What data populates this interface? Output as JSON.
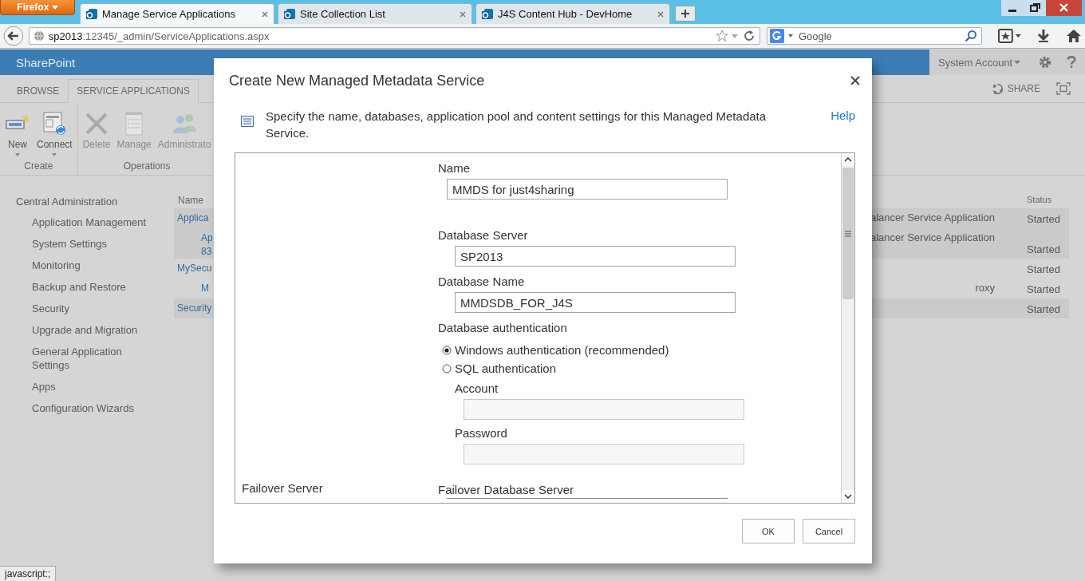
{
  "browser": {
    "menu_button": "Firefox",
    "tabs": [
      {
        "title": "Manage Service Applications",
        "selected": true
      },
      {
        "title": "Site Collection List",
        "selected": false
      },
      {
        "title": "J4S Content Hub - DevHome",
        "selected": false
      }
    ],
    "url_host": "sp2013",
    "url_rest": ":12345/_admin/ServiceApplications.aspx",
    "search": {
      "placeholder": "Google"
    },
    "status_text": "javascript:;"
  },
  "suite_bar": {
    "brand": "SharePoint",
    "account": "System Account"
  },
  "ribbon": {
    "tabs": [
      {
        "label": "BROWSE",
        "selected": false
      },
      {
        "label": "SERVICE APPLICATIONS",
        "selected": true
      }
    ],
    "share": "SHARE",
    "groups": [
      {
        "label": "Create",
        "buttons": [
          {
            "label": "New",
            "dropdown": true,
            "disabled": false
          },
          {
            "label": "Connect",
            "dropdown": true,
            "disabled": false
          }
        ]
      },
      {
        "label": "Operations",
        "buttons": [
          {
            "label": "Delete",
            "dropdown": false,
            "disabled": true
          },
          {
            "label": "Manage",
            "dropdown": false,
            "disabled": true
          },
          {
            "label": "Administrato",
            "dropdown": false,
            "disabled": true
          }
        ]
      }
    ]
  },
  "left_nav": [
    {
      "label": "Central Administration",
      "children": [
        {
          "label": "Application Management"
        },
        {
          "label": "System Settings"
        },
        {
          "label": "Monitoring"
        },
        {
          "label": "Backup and Restore"
        },
        {
          "label": "Security"
        },
        {
          "label": "Upgrade and Migration"
        },
        {
          "label": "General Application Settings"
        },
        {
          "label": "Apps"
        },
        {
          "label": "Configuration Wizards"
        }
      ]
    }
  ],
  "table": {
    "columns": [
      "Name",
      "Status"
    ],
    "rows": [
      {
        "name": [
          "Applica"
        ],
        "type": "alancer Service Application",
        "status": "Started",
        "children": [
          {
            "name": [
              "Ap",
              "83"
            ],
            "type": "alancer Service Application",
            "status": "Started"
          }
        ]
      },
      {
        "name": [
          "MySecu"
        ],
        "status": "Started",
        "children": [
          {
            "name": [
              "M"
            ],
            "type": "roxy",
            "status": "Started"
          }
        ]
      },
      {
        "name": [
          "Security"
        ],
        "status": "Started"
      }
    ]
  },
  "dialog": {
    "title": "Create New Managed Metadata Service",
    "description": "Specify the name, databases, application pool and content settings for this Managed Metadata Service.",
    "help": "Help",
    "fields": [
      {
        "kind": "text",
        "label": "Name",
        "value": "MMDS for just4sharing"
      },
      {
        "kind": "text",
        "label": "Database Server",
        "value": "SP2013"
      },
      {
        "kind": "text",
        "label": "Database Name",
        "value": "MMDSDB_FOR_J4S"
      },
      {
        "kind": "radio",
        "label": "Database authentication",
        "options": [
          {
            "label": "Windows authentication (recommended)",
            "selected": true
          },
          {
            "label": "SQL authentication",
            "selected": false
          }
        ],
        "subfields": [
          {
            "label": "Account",
            "disabled": true
          },
          {
            "label": "Password",
            "disabled": true
          }
        ]
      }
    ],
    "section_label": "Failover Server",
    "last_field": "Failover Database Server",
    "buttons": [
      "OK",
      "Cancel"
    ]
  }
}
